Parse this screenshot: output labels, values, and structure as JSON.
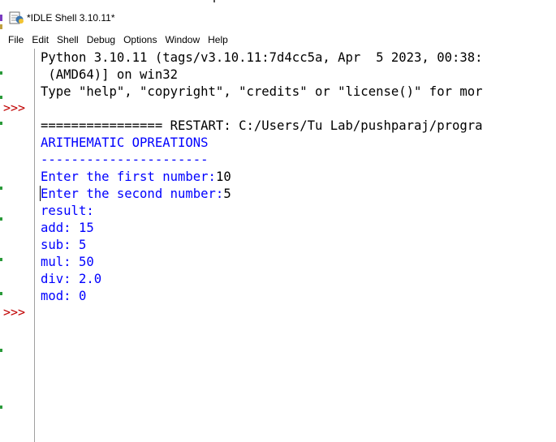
{
  "window": {
    "title": "*IDLE Shell 3.10.11*",
    "icon": "idle-python-icon"
  },
  "menu": {
    "items": [
      "File",
      "Edit",
      "Shell",
      "Debug",
      "Options",
      "Window",
      "Help"
    ]
  },
  "shell": {
    "prompt": ">>>",
    "banner": [
      "Python 3.10.11 (tags/v3.10.11:7d4cc5a, Apr  5 2023, 00:38:",
      " (AMD64)] on win32",
      "Type \"help\", \"copyright\", \"credits\" or \"license()\" for mor"
    ],
    "restart": "================ RESTART: C:/Users/Tu Lab/pushparaj/progra",
    "output": {
      "heading": "ARITHEMATIC OPREATIONS",
      "divider": "----------------------",
      "prompt_first": "Enter the first number:",
      "input_first": "10",
      "prompt_second": "Enter the second number:",
      "input_second": "5",
      "result_label": "result:",
      "add": "add: 15",
      "sub": "sub: 5",
      "mul": "mul: 50",
      "div": "div: 2.0",
      "mod": "mod: 0"
    }
  },
  "colors": {
    "prompt": "#c00000",
    "stdout": "#0000ff",
    "text": "#000000"
  }
}
